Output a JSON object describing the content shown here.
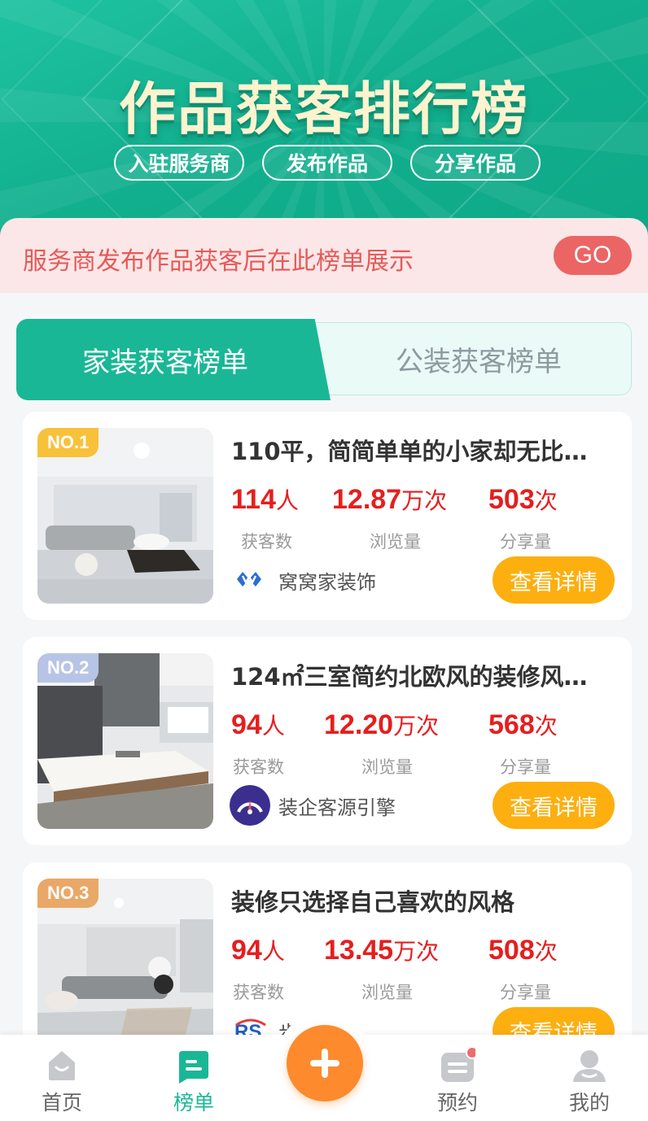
{
  "header": {
    "title": "作品获客排行榜",
    "buttons": [
      "入驻服务商",
      "发布作品",
      "分享作品"
    ]
  },
  "notice": {
    "text": "服务商发布作品获客后在此榜单展示",
    "go_label": "GO"
  },
  "tabs": {
    "active": "家装获客榜单",
    "inactive": "公装获客榜单"
  },
  "stat_labels": {
    "customers": "获客数",
    "views": "浏览量",
    "shares": "分享量"
  },
  "units": {
    "people": "人",
    "times": "次",
    "ten_thousand_times": "万次"
  },
  "detail_label": "查看详情",
  "cards": [
    {
      "rank": "NO.1",
      "title": "110平，简简单单的小家却无比…",
      "customers": "114",
      "views": "12.87",
      "shares": "503",
      "merchant": "窝窝家装饰"
    },
    {
      "rank": "NO.2",
      "title": "124㎡三室简约北欧风的装修风…",
      "customers": "94",
      "views": "12.20",
      "shares": "568",
      "merchant": "装企客源引擎"
    },
    {
      "rank": "NO.3",
      "title": "装修只选择自己喜欢的风格",
      "customers": "94",
      "views": "13.45",
      "shares": "508",
      "merchant": "步"
    }
  ],
  "nav": {
    "home": "首页",
    "rank": "榜单",
    "booking": "预约",
    "mine": "我的"
  },
  "colors": {
    "brand_green": "#1ab796",
    "stat_red": "#e61e1e",
    "detail_orange": "#fdaf10",
    "fab_orange": "#fd8a2c",
    "rank1_gold": "#f7c23a",
    "rank2_silver": "#b8c4e6",
    "rank3_bronze": "#e9a867"
  }
}
